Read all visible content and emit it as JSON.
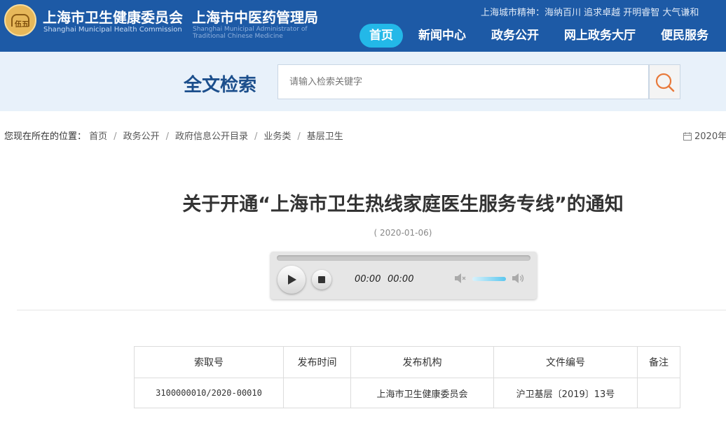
{
  "header": {
    "logo_text": "伍五",
    "org1_cn": "上海市卫生健康委员会",
    "org1_en": "Shanghai Municipal Health Commission",
    "org2_cn": "上海市中医药管理局",
    "org2_en": "Shanghai Municipal Administrator of Traditional Chinese Medicine",
    "city_spirit": "上海城市精神：海纳百川 追求卓越 开明睿智 大气谦和",
    "nav": [
      "首页",
      "新闻中心",
      "政务公开",
      "网上政务大厅",
      "便民服务"
    ],
    "active_nav": "首页",
    "colors": {
      "header_bg": "#1d5aa6",
      "nav_active": "#23b8e8"
    }
  },
  "search": {
    "title": "全文检索",
    "placeholder": "请输入检索关键字",
    "button_icon": "search-icon",
    "icon_color": "#e8793a"
  },
  "breadcrumb": {
    "prefix": "您现在所在的位置：",
    "items": [
      "首页",
      "政务公开",
      "政府信息公开目录",
      "业务类",
      "基层卫生"
    ],
    "separator": "/",
    "date_icon": "calendar-icon",
    "date_text": "2020年"
  },
  "article": {
    "title": "关于开通“上海市卫生热线家庭医生服务专线”的通知",
    "date": "( 2020-01-06)"
  },
  "audio": {
    "current_time": "00:00",
    "duration": "00:00",
    "progress_fraction": 0,
    "volume_fraction": 0.8
  },
  "meta_table": {
    "headers": [
      "索取号",
      "发布时间",
      "发布机构",
      "文件编号",
      "备注"
    ],
    "row": [
      "3100000010/2020-00010",
      "",
      "上海市卫生健康委员会",
      "沪卫基层〔2019〕13号",
      ""
    ]
  }
}
